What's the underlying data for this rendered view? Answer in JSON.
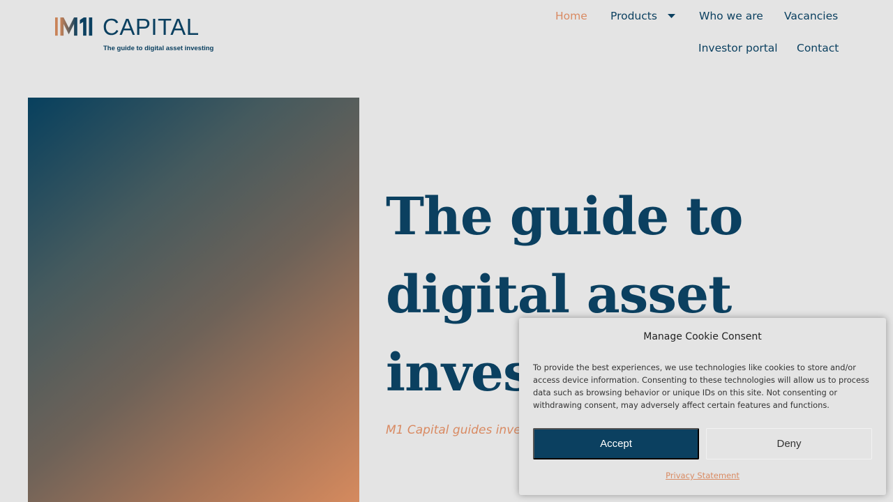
{
  "brand": {
    "name": "CAPITAL",
    "tagline": "The guide to digital asset investing",
    "colors": {
      "primary": "#0b4060",
      "accent": "#d98a62",
      "background": "#e4e4e4"
    }
  },
  "nav": {
    "items": [
      {
        "label": "Home",
        "active": true
      },
      {
        "label": "Products",
        "active": false,
        "has_dropdown": true,
        "icon": "caret-down-icon"
      },
      {
        "label": "Who we are",
        "active": false
      },
      {
        "label": "Vacancies",
        "active": false
      },
      {
        "label": "Investor portal",
        "active": false
      },
      {
        "label": "Contact",
        "active": false
      }
    ]
  },
  "hero": {
    "title_lines": [
      "The guide to",
      "digital asset",
      "invest"
    ],
    "subtitle": "M1 Capital guides inves"
  },
  "cookie": {
    "title": "Manage Cookie Consent",
    "text": "To provide the best experiences, we use technologies like cookies to store and/or access device information. Consenting to these technologies will allow us to process data such as browsing behavior or unique IDs on this site. Not consenting or withdrawing consent, may adversely affect certain features and functions.",
    "accept_label": "Accept",
    "deny_label": "Deny",
    "privacy_label": "Privacy Statement"
  }
}
